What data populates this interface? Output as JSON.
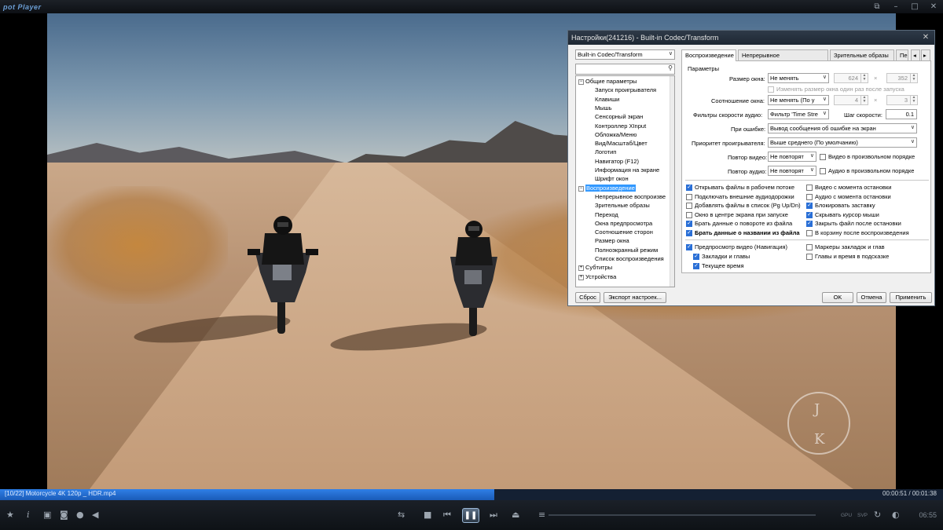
{
  "app": {
    "logo": "pot Player",
    "window_buttons": [
      "⧉",
      "–",
      "□",
      "✕"
    ]
  },
  "dialog": {
    "title": "Настройки(241216) - Built-in Codec/Transform",
    "close": "✕",
    "preset_combo": "Built-in Codec/Transform",
    "tree": [
      {
        "label": "Общие параметры",
        "level": 0
      },
      {
        "label": "Запуск проигрывателя",
        "level": 1
      },
      {
        "label": "Клавиши",
        "level": 1
      },
      {
        "label": "Мышь",
        "level": 1
      },
      {
        "label": "Сенсорный экран",
        "level": 1
      },
      {
        "label": "Контроллер XInput",
        "level": 1
      },
      {
        "label": "Обложка/Меню",
        "level": 1
      },
      {
        "label": "Вид/Масштаб/Цвет",
        "level": 1
      },
      {
        "label": "Логотип",
        "level": 1
      },
      {
        "label": "Навигатор (F12)",
        "level": 1
      },
      {
        "label": "Информация на экране",
        "level": 1
      },
      {
        "label": "Шрифт окон",
        "level": 1
      },
      {
        "label": "Воспроизведение",
        "level": 0
      },
      {
        "label": "Непрерывное воспроизве",
        "level": 1
      },
      {
        "label": "Зрительные образы",
        "level": 1
      },
      {
        "label": "Переход",
        "level": 1
      },
      {
        "label": "Окна предпросмотра",
        "level": 1
      },
      {
        "label": "Соотношение сторон",
        "level": 1
      },
      {
        "label": "Размер окна",
        "level": 1
      },
      {
        "label": "Полноэкранный режим",
        "level": 1
      },
      {
        "label": "Список воспроизведения",
        "level": 1
      },
      {
        "label": "Субтитры",
        "level": 0
      },
      {
        "label": "Устройства",
        "level": 0
      }
    ],
    "tabs": [
      "Воспроизведение",
      "Непрерывное воспроизведение",
      "Зрительные образы",
      "Пер"
    ],
    "tab_arrows": [
      "◂",
      "▸"
    ],
    "section_title": "Параметры",
    "rows": {
      "window_size_label": "Размер окна:",
      "window_size_value": "Не менять",
      "window_w": "624",
      "window_h": "352",
      "x_sign": "×",
      "change_once_label": "Изменять размер окна один раз после запуска",
      "aspect_label": "Соотношение окна:",
      "aspect_value": "Не менять (По у",
      "aspect_w": "4",
      "aspect_h": "3",
      "audio_speed_filter_label": "Фильтры скорости аудио:",
      "audio_speed_filter_value": "Фильтр 'Time Stre",
      "speed_step_label": "Шаг скорости:",
      "speed_step_value": "0.1",
      "on_error_label": "При ошибке:",
      "on_error_value": "Вывод сообщения об ошибке на экран",
      "priority_label": "Приоритет проигрывателя:",
      "priority_value": "Выше среднего (По умолчанию)",
      "repeat_video_label": "Повтор видео:",
      "repeat_video_value": "Не повторят",
      "video_random_label": "Видео в произвольном порядке",
      "repeat_audio_label": "Повтор аудио:",
      "repeat_audio_value": "Не повторят",
      "audio_random_label": "Аудио в произвольном порядке"
    },
    "checks_left": [
      {
        "label": "Открывать файлы в рабочем потоке",
        "on": true,
        "bold": false
      },
      {
        "label": "Подключать внешние аудиодорожки",
        "on": false,
        "bold": false
      },
      {
        "label": "Добавлять файлы в список (Pg Up/Dn)",
        "on": false,
        "bold": false
      },
      {
        "label": "Окно в центре экрана при запуске",
        "on": false,
        "bold": false
      },
      {
        "label": "Брать данные о повороте из файла",
        "on": true,
        "bold": false
      },
      {
        "label": "Брать данные о названии из файла",
        "on": true,
        "bold": true
      }
    ],
    "checks_right": [
      {
        "label": "Видео с момента остановки",
        "on": false
      },
      {
        "label": "Аудио с момента остановки",
        "on": false
      },
      {
        "label": "Блокировать заставку",
        "on": true
      },
      {
        "label": "Скрывать курсор мыши",
        "on": true
      },
      {
        "label": "Закрыть файл после остановки",
        "on": true
      },
      {
        "label": "В корзину после воспроизведения",
        "on": false
      }
    ],
    "nav_checks": [
      {
        "label": "Предпросмотр видео (Навигация)",
        "on": true
      },
      {
        "label": "Маркеры закладок и глав",
        "on": false
      },
      {
        "label": "Закладки и главы",
        "on": true
      },
      {
        "label": "Главы и время в подсказке",
        "on": false
      },
      {
        "label": "Текущее время",
        "on": true
      }
    ],
    "buttons": {
      "reset": "Сброс",
      "export": "Экспорт настроек...",
      "ok": "OK",
      "cancel": "Отмена",
      "apply": "Применить"
    }
  },
  "player": {
    "file_title": "[10/22] Motorcycle 4K 120p _ HDR.mp4",
    "time": "00:00:51 / 00:01:38",
    "progress": 0.524,
    "clock": "06:55",
    "badges": [
      "GPU",
      "SVP"
    ],
    "watermark": [
      "J",
      "K"
    ]
  }
}
